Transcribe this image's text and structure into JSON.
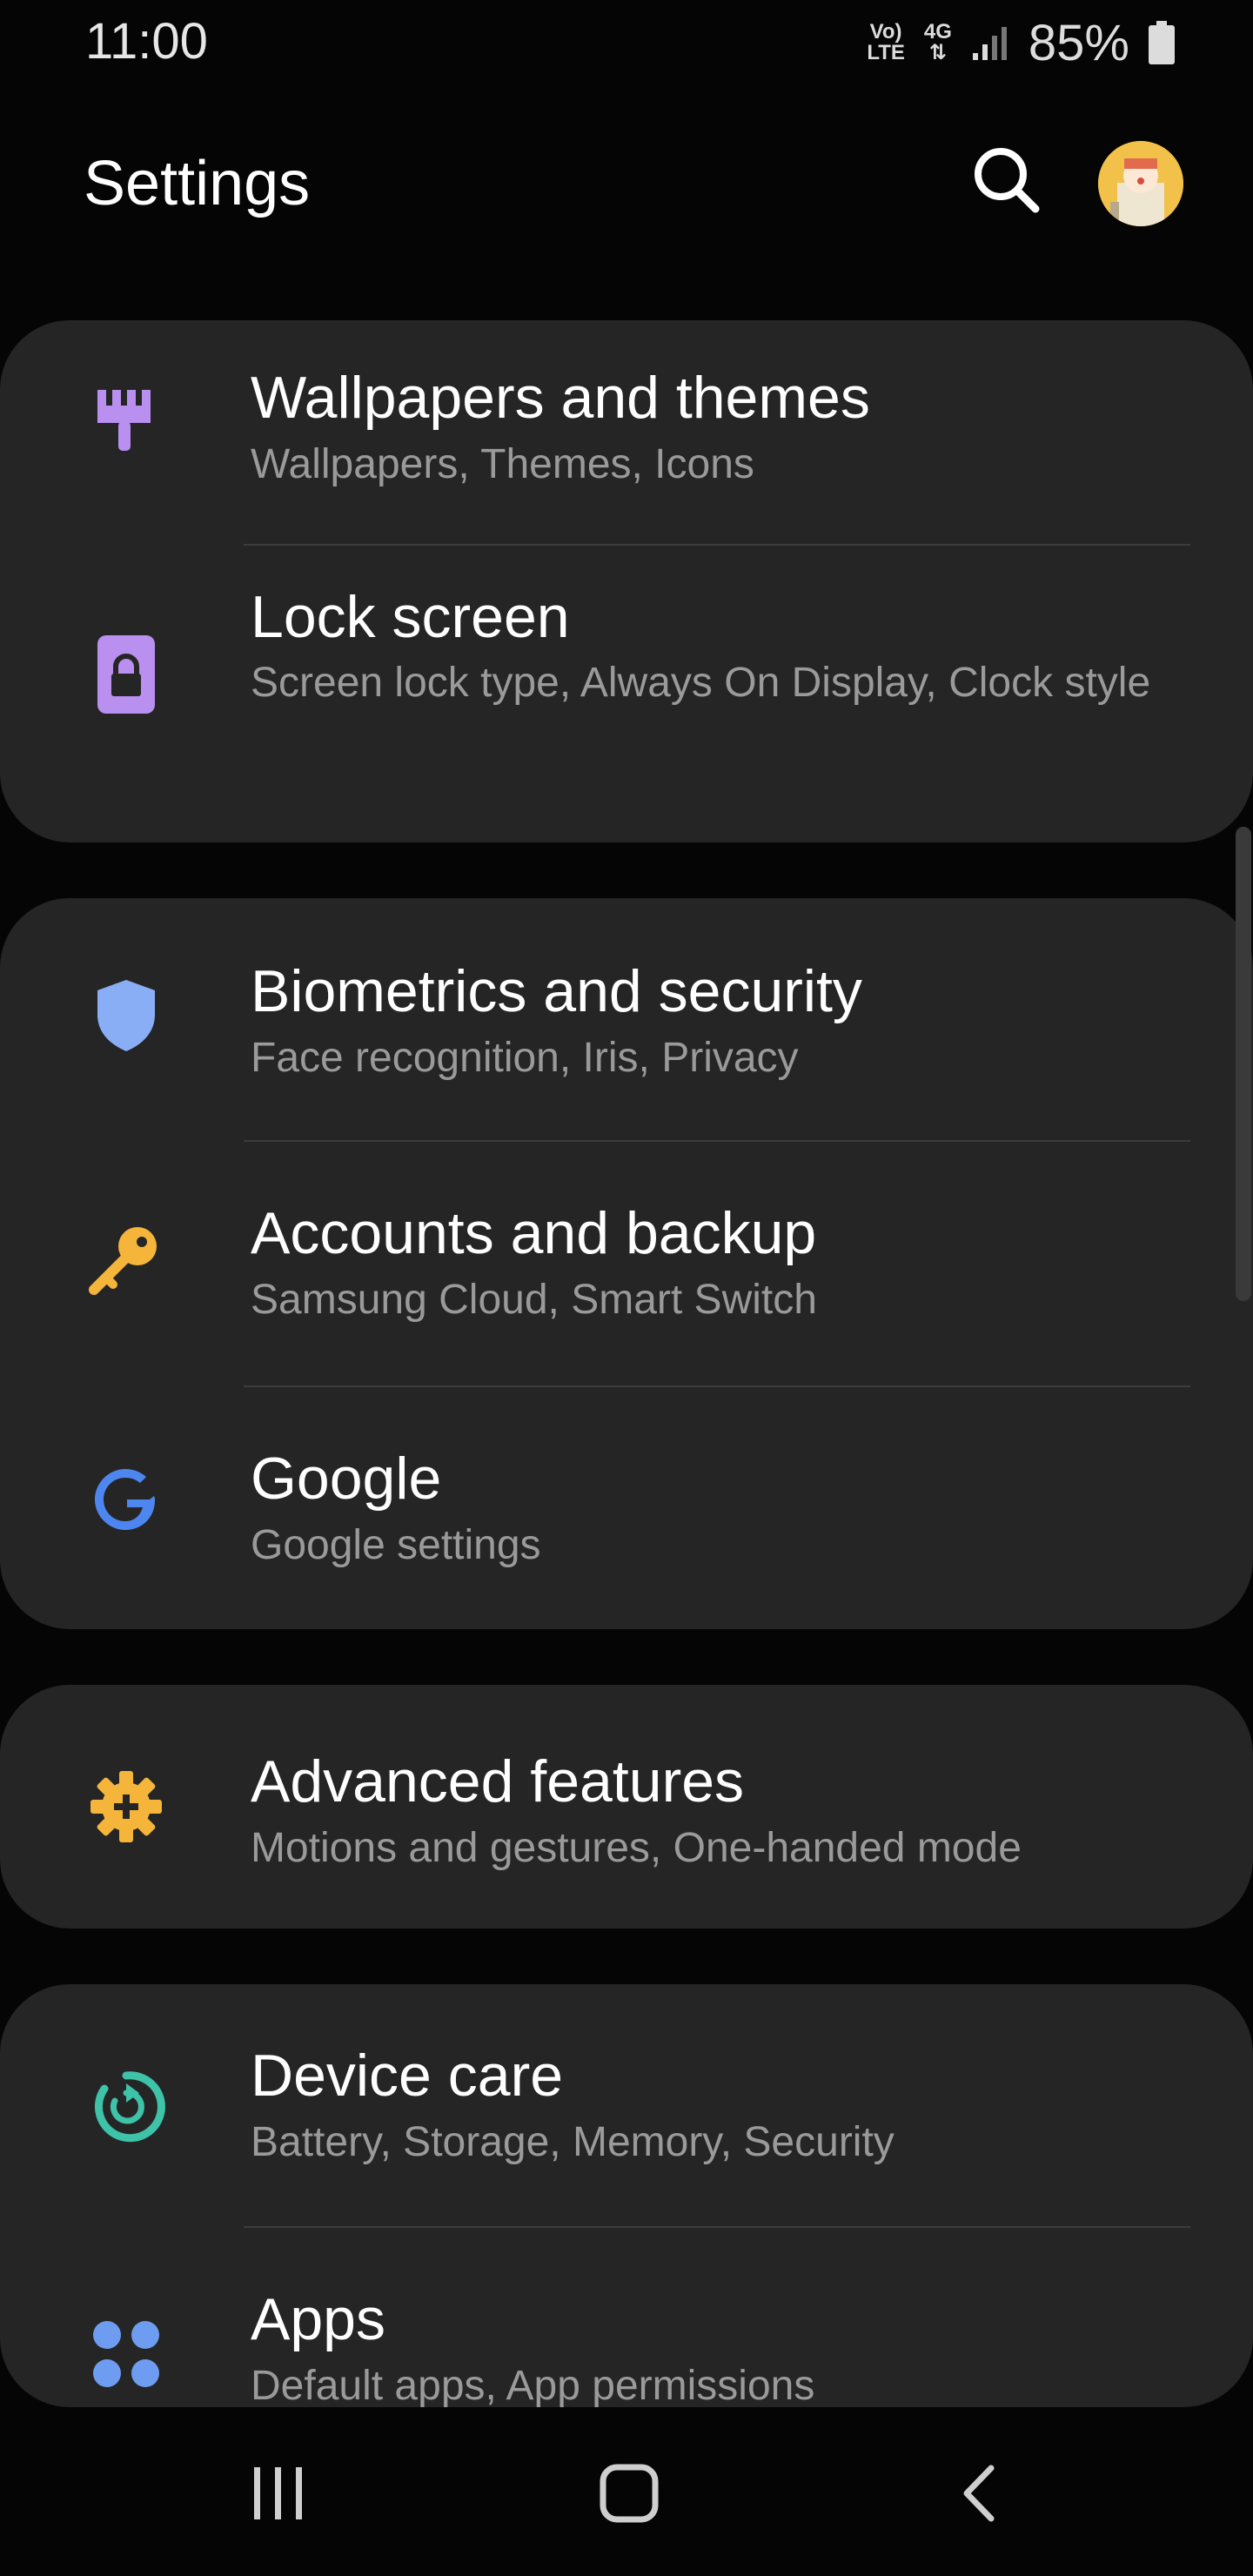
{
  "status_bar": {
    "time": "11:00",
    "volte_top": "Vo)",
    "volte_bottom": "LTE",
    "network": "4G",
    "battery": "85%"
  },
  "header": {
    "title": "Settings",
    "search_icon": "search-icon",
    "avatar": "profile-avatar"
  },
  "cards": [
    {
      "items": [
        {
          "title": "Wallpapers and themes",
          "subtitle": "Wallpapers, Themes, Icons",
          "icon": "paintbrush-icon",
          "color": "#b98ff0"
        },
        {
          "title": "Lock screen",
          "subtitle": "Screen lock type, Always On Display, Clock style",
          "icon": "lock-icon",
          "color": "#b98ff0"
        }
      ]
    },
    {
      "items": [
        {
          "title": "Biometrics and security",
          "subtitle": "Face recognition, Iris, Privacy",
          "icon": "shield-icon",
          "color": "#8aaef5"
        },
        {
          "title": "Accounts and backup",
          "subtitle": "Samsung Cloud, Smart Switch",
          "icon": "key-icon",
          "color": "#f5b53b"
        },
        {
          "title": "Google",
          "subtitle": "Google settings",
          "icon": "google-icon",
          "color": "#4e86f0"
        }
      ]
    },
    {
      "items": [
        {
          "title": "Advanced features",
          "subtitle": "Motions and gestures, One-handed mode",
          "icon": "gear-plus-icon",
          "color": "#f5b53b"
        }
      ]
    },
    {
      "items": [
        {
          "title": "Device care",
          "subtitle": "Battery, Storage, Memory, Security",
          "icon": "device-care-icon",
          "color": "#3ec2a8"
        },
        {
          "title": "Apps",
          "subtitle": "Default apps, App permissions",
          "icon": "apps-icon",
          "color": "#6e9cf0"
        }
      ]
    }
  ],
  "nav_bar": {
    "recents_icon": "recents-icon",
    "home_icon": "home-icon",
    "back_icon": "back-icon"
  }
}
